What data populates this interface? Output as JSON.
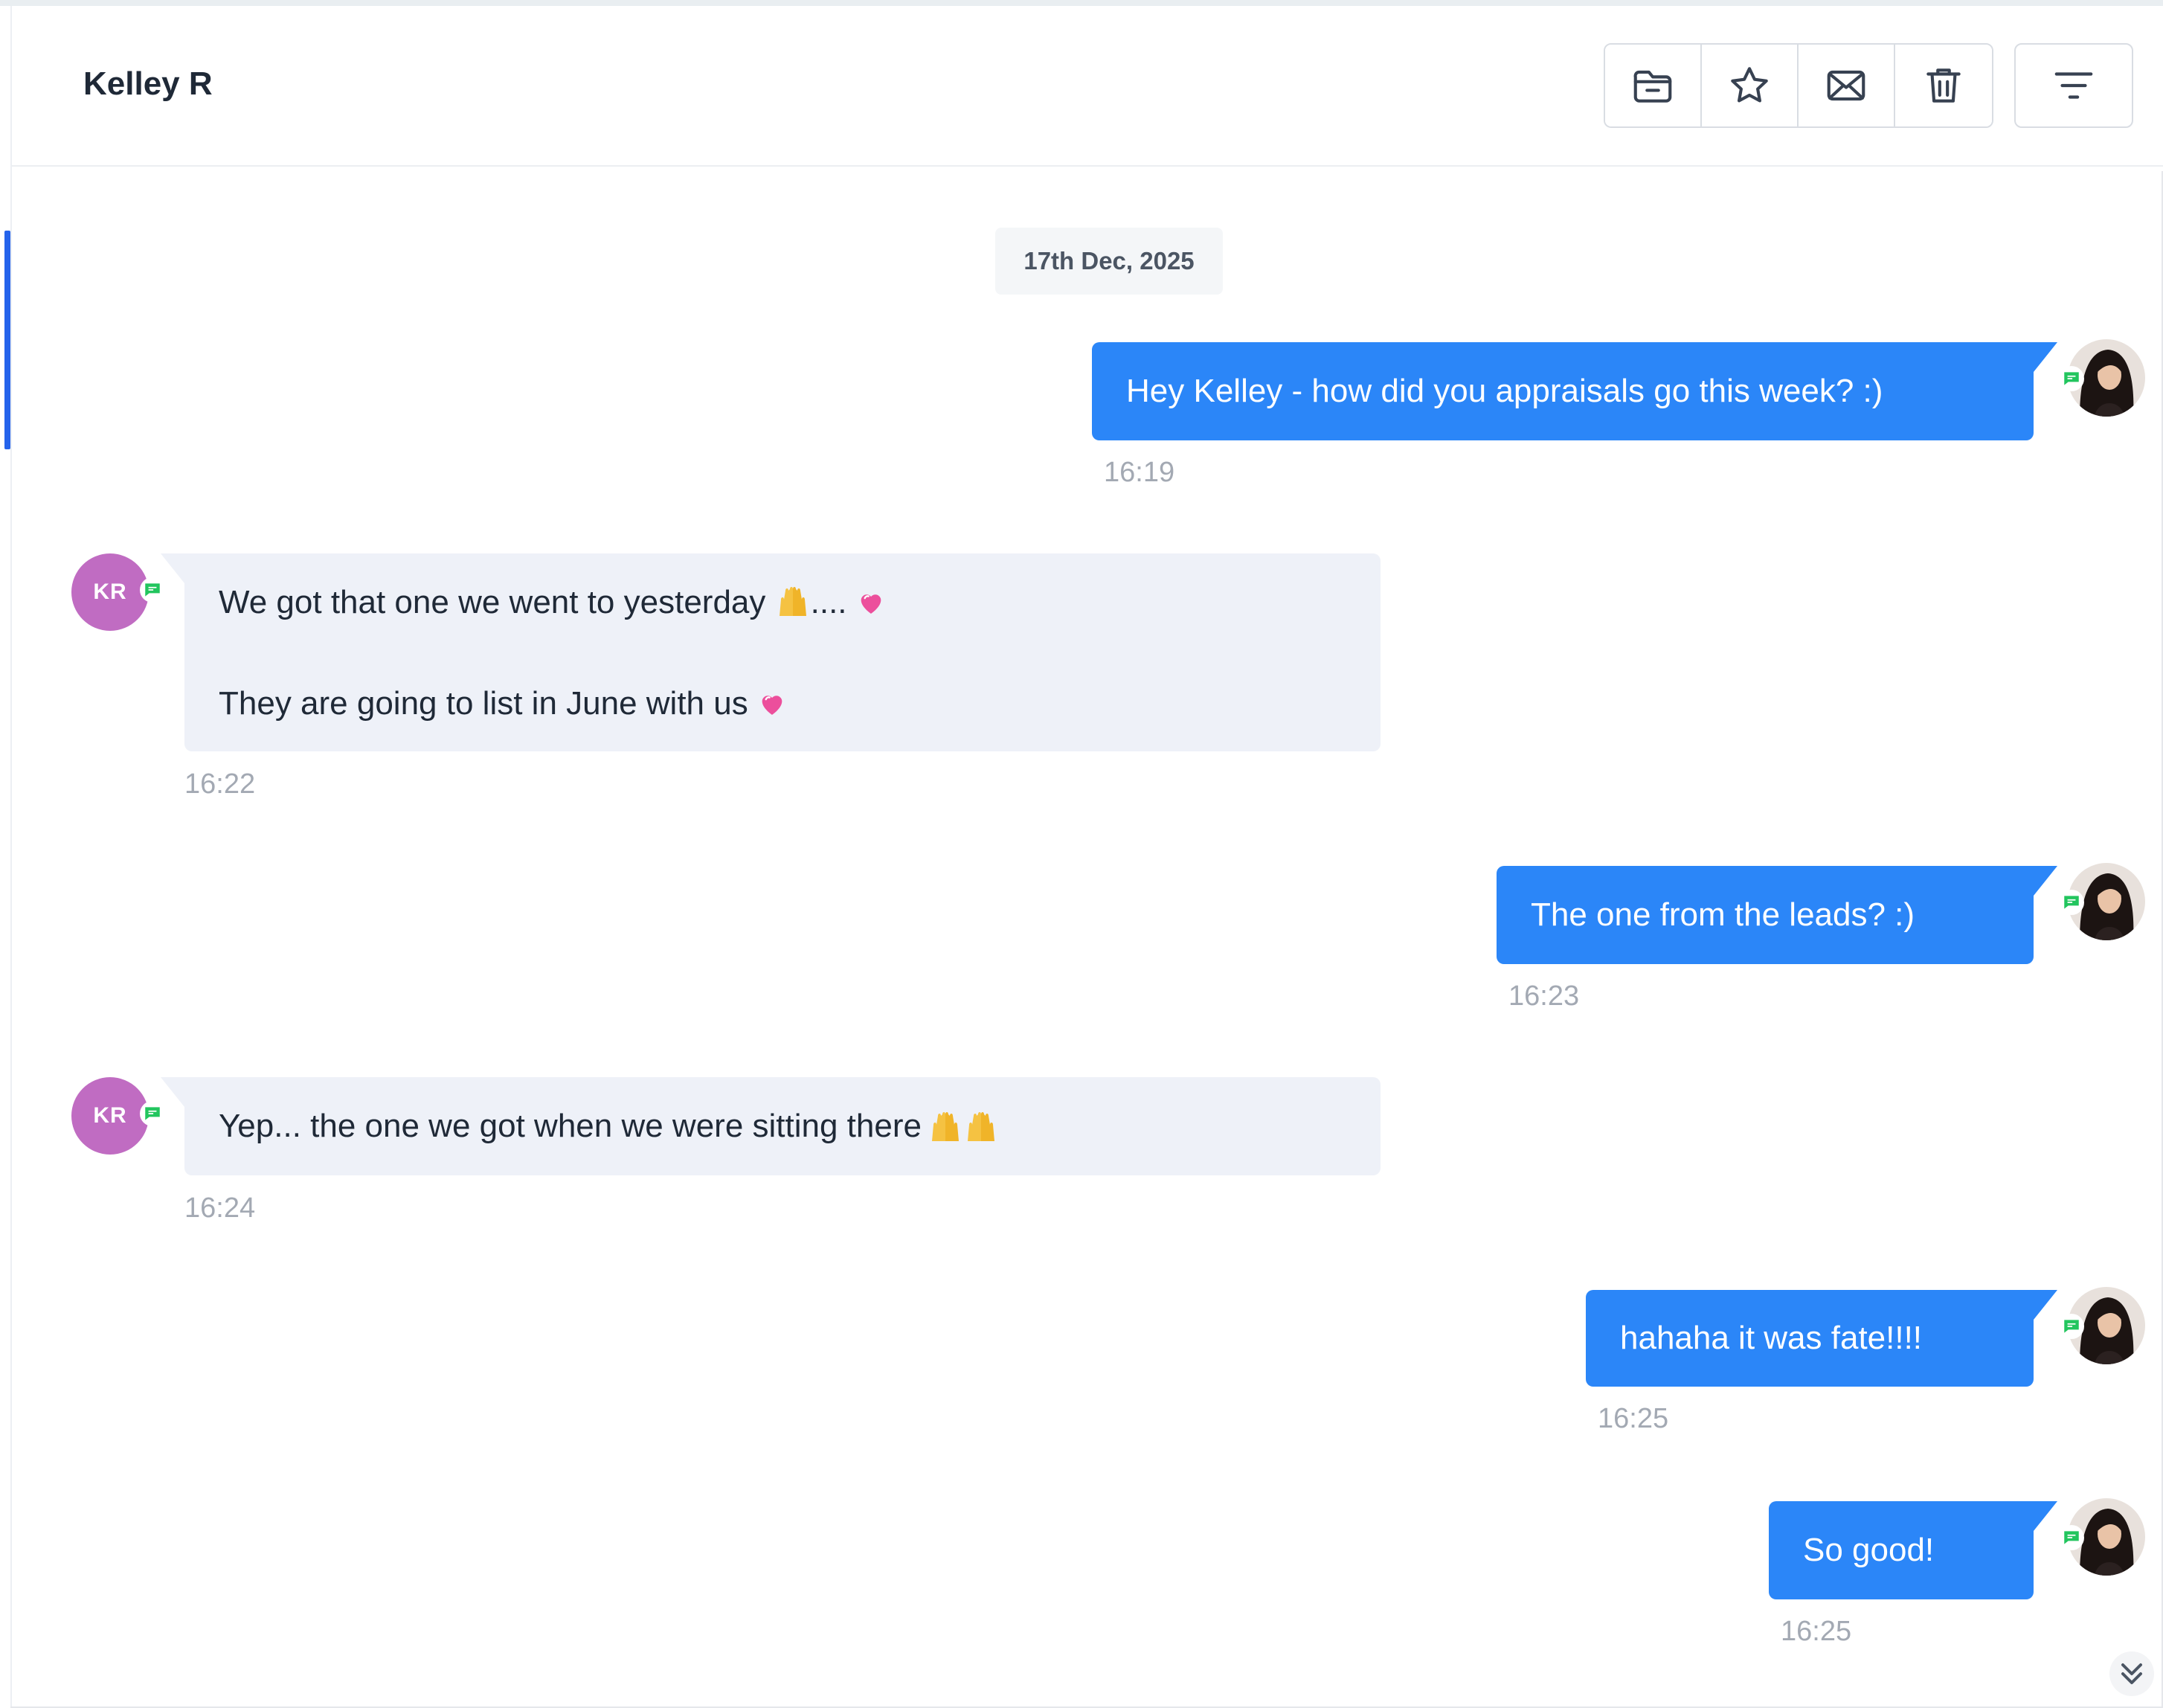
{
  "header": {
    "contact_name": "Kelley R",
    "toolbar": [
      {
        "name": "folder-minus-icon",
        "label": "Archive"
      },
      {
        "name": "star-icon",
        "label": "Star"
      },
      {
        "name": "mail-icon",
        "label": "Mark as unread"
      },
      {
        "name": "trash-icon",
        "label": "Delete"
      }
    ],
    "filter_icon": "filter-lines-icon"
  },
  "conversation": {
    "date_separator": "17th Dec, 2025",
    "messages": [
      {
        "direction": "outgoing",
        "lines": [
          "Hey Kelley - how did you appraisals go this week? :)"
        ],
        "time": "16:19"
      },
      {
        "direction": "incoming",
        "avatar_initials": "KR",
        "lines": [
          "We got that one we went to yesterday",
          "....",
          "They are going to list in June with us"
        ],
        "time": "16:22"
      },
      {
        "direction": "outgoing",
        "lines": [
          "The one from the leads? :)"
        ],
        "time": "16:23"
      },
      {
        "direction": "incoming",
        "avatar_initials": "KR",
        "lines": [
          "Yep... the one we got when we were sitting there"
        ],
        "time": "16:24"
      },
      {
        "direction": "outgoing",
        "lines": [
          "hahaha it was fate!!!!"
        ],
        "time": "16:25"
      },
      {
        "direction": "outgoing",
        "lines": [
          "So good!"
        ],
        "time": "16:25"
      }
    ]
  },
  "colors": {
    "outgoing_bubble": "#2b86f8",
    "incoming_bubble": "#eef1f8",
    "contact_avatar": "#c06cc2",
    "sms_badge": "#22c55e",
    "accent": "#2563eb"
  }
}
